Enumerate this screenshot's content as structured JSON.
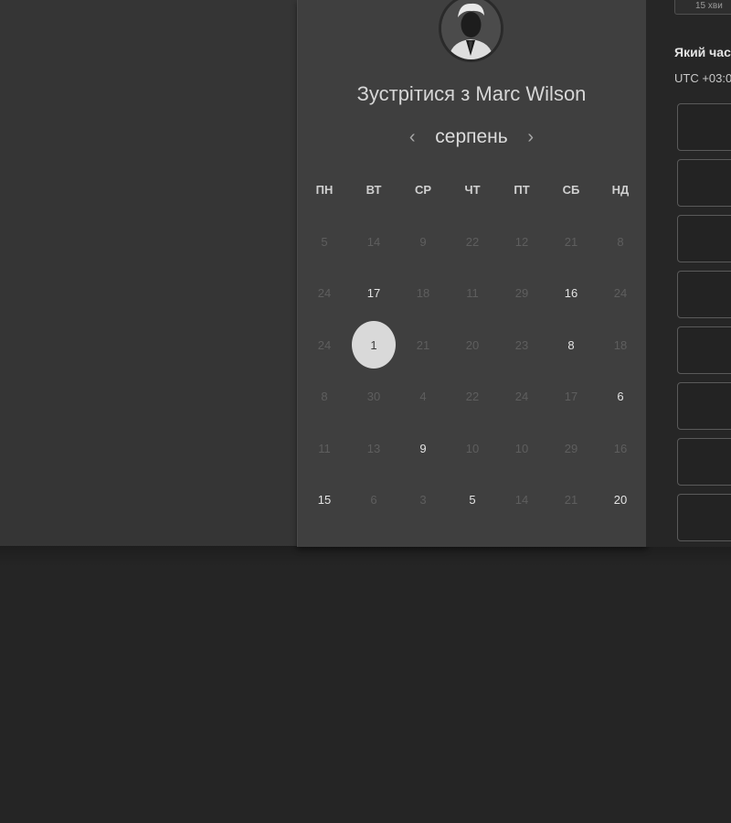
{
  "booking": {
    "title": "Зустрітися з Marc Wilson",
    "month": "серпень",
    "prev_icon": "chevron-left-icon",
    "next_icon": "chevron-right-icon"
  },
  "weekdays": [
    "ПН",
    "ВТ",
    "СР",
    "ЧТ",
    "ПТ",
    "СБ",
    "НД"
  ],
  "weeks": [
    [
      {
        "n": "5"
      },
      {
        "n": "14"
      },
      {
        "n": "9"
      },
      {
        "n": "22"
      },
      {
        "n": "12"
      },
      {
        "n": "21"
      },
      {
        "n": "8"
      }
    ],
    [
      {
        "n": "24"
      },
      {
        "n": "17",
        "a": true
      },
      {
        "n": "18"
      },
      {
        "n": "11"
      },
      {
        "n": "29"
      },
      {
        "n": "16",
        "a": true
      },
      {
        "n": "24"
      }
    ],
    [
      {
        "n": "24"
      },
      {
        "n": "1",
        "a": true,
        "s": true
      },
      {
        "n": "21"
      },
      {
        "n": "20"
      },
      {
        "n": "23"
      },
      {
        "n": "8",
        "a": true
      },
      {
        "n": "18"
      }
    ],
    [
      {
        "n": "8"
      },
      {
        "n": "30"
      },
      {
        "n": "4"
      },
      {
        "n": "22"
      },
      {
        "n": "24"
      },
      {
        "n": "17"
      },
      {
        "n": "6",
        "a": true
      }
    ],
    [
      {
        "n": "11"
      },
      {
        "n": "13"
      },
      {
        "n": "9",
        "a": true
      },
      {
        "n": "10"
      },
      {
        "n": "10"
      },
      {
        "n": "29"
      },
      {
        "n": "16"
      }
    ],
    [
      {
        "n": "15",
        "a": true
      },
      {
        "n": "6"
      },
      {
        "n": "3"
      },
      {
        "n": "5",
        "a": true
      },
      {
        "n": "14"
      },
      {
        "n": "21"
      },
      {
        "n": "20",
        "a": true
      }
    ]
  ],
  "side": {
    "duration": "15 хви",
    "question": "Який час",
    "timezone": "UTC +03:0"
  },
  "slots_count": 8
}
